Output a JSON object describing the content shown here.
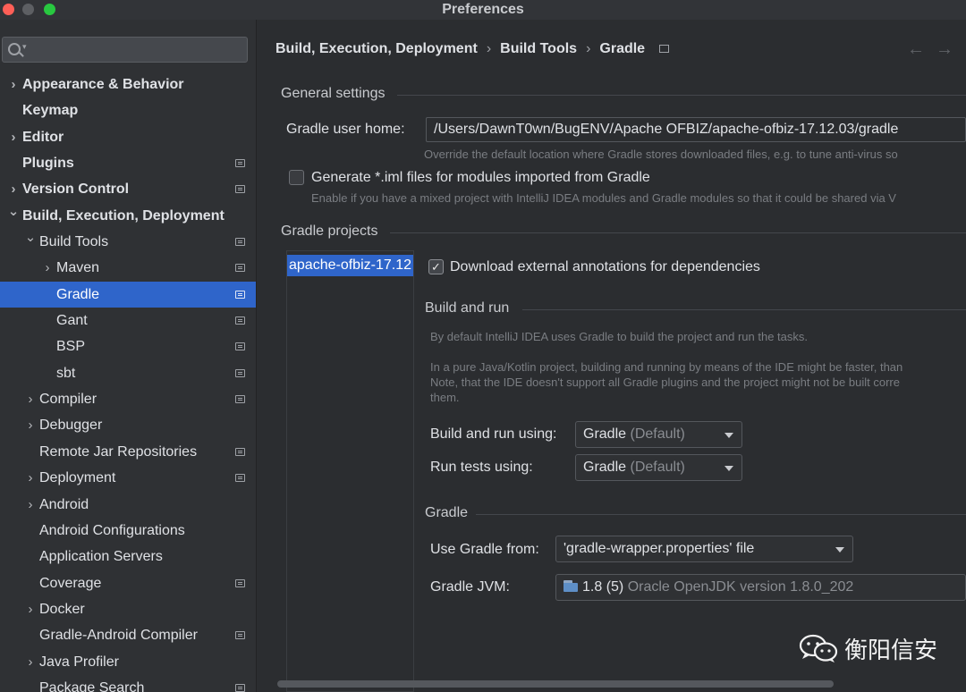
{
  "window": {
    "title": "Preferences"
  },
  "sidebar": {
    "search": {
      "placeholder": "",
      "value": ""
    },
    "items": [
      {
        "label": "Appearance & Behavior",
        "bold": true,
        "chevron": "collapsed",
        "indent": 0,
        "settings_icon": false
      },
      {
        "label": "Keymap",
        "bold": true,
        "chevron": "none",
        "indent": 0,
        "settings_icon": false
      },
      {
        "label": "Editor",
        "bold": true,
        "chevron": "collapsed",
        "indent": 0,
        "settings_icon": false
      },
      {
        "label": "Plugins",
        "bold": true,
        "chevron": "none",
        "indent": 0,
        "settings_icon": true
      },
      {
        "label": "Version Control",
        "bold": true,
        "chevron": "collapsed",
        "indent": 0,
        "settings_icon": true
      },
      {
        "label": "Build, Execution, Deployment",
        "bold": true,
        "chevron": "expanded",
        "indent": 0,
        "settings_icon": false
      },
      {
        "label": "Build Tools",
        "bold": false,
        "chevron": "expanded",
        "indent": 1,
        "settings_icon": true
      },
      {
        "label": "Maven",
        "bold": false,
        "chevron": "collapsed",
        "indent": 2,
        "settings_icon": true
      },
      {
        "label": "Gradle",
        "bold": false,
        "chevron": "none",
        "indent": 2,
        "settings_icon": true,
        "selected": true
      },
      {
        "label": "Gant",
        "bold": false,
        "chevron": "none",
        "indent": 2,
        "settings_icon": true
      },
      {
        "label": "BSP",
        "bold": false,
        "chevron": "none",
        "indent": 2,
        "settings_icon": true
      },
      {
        "label": "sbt",
        "bold": false,
        "chevron": "none",
        "indent": 2,
        "settings_icon": true
      },
      {
        "label": "Compiler",
        "bold": false,
        "chevron": "collapsed",
        "indent": 1,
        "settings_icon": true
      },
      {
        "label": "Debugger",
        "bold": false,
        "chevron": "collapsed",
        "indent": 1,
        "settings_icon": false
      },
      {
        "label": "Remote Jar Repositories",
        "bold": false,
        "chevron": "none",
        "indent": 1,
        "settings_icon": true
      },
      {
        "label": "Deployment",
        "bold": false,
        "chevron": "collapsed",
        "indent": 1,
        "settings_icon": true
      },
      {
        "label": "Android",
        "bold": false,
        "chevron": "collapsed",
        "indent": 1,
        "settings_icon": false
      },
      {
        "label": "Android Configurations",
        "bold": false,
        "chevron": "none",
        "indent": 1,
        "settings_icon": false
      },
      {
        "label": "Application Servers",
        "bold": false,
        "chevron": "none",
        "indent": 1,
        "settings_icon": false
      },
      {
        "label": "Coverage",
        "bold": false,
        "chevron": "none",
        "indent": 1,
        "settings_icon": true
      },
      {
        "label": "Docker",
        "bold": false,
        "chevron": "collapsed",
        "indent": 1,
        "settings_icon": false
      },
      {
        "label": "Gradle-Android Compiler",
        "bold": false,
        "chevron": "none",
        "indent": 1,
        "settings_icon": true
      },
      {
        "label": "Java Profiler",
        "bold": false,
        "chevron": "collapsed",
        "indent": 1,
        "settings_icon": false
      },
      {
        "label": "Package Search",
        "bold": false,
        "chevron": "none",
        "indent": 1,
        "settings_icon": true
      }
    ]
  },
  "breadcrumb": {
    "items": [
      "Build, Execution, Deployment",
      "Build Tools",
      "Gradle"
    ]
  },
  "general": {
    "section_title": "General settings",
    "user_home_label": "Gradle user home:",
    "user_home_value": "/Users/DawnT0wn/BugENV/Apache OFBIZ/apache-ofbiz-17.12.03/gradle",
    "user_home_hint": "Override the default location where Gradle stores downloaded files, e.g. to tune anti-virus so",
    "generate_iml_label": "Generate *.iml files for modules imported from Gradle",
    "generate_iml_checked": false,
    "generate_iml_hint": "Enable if you have a mixed project with IntelliJ IDEA modules and Gradle modules so that it could be shared via V"
  },
  "projects": {
    "section_title": "Gradle projects",
    "items": [
      "apache-ofbiz-17.12"
    ],
    "download_annotations_label": "Download external annotations for dependencies",
    "download_annotations_checked": true,
    "build_run": {
      "title": "Build and run",
      "desc1": "By default IntelliJ IDEA uses Gradle to build the project and run the tasks.",
      "desc2_line1": "In a pure Java/Kotlin project, building and running by means of the IDE might be faster, than",
      "desc2_line2": "Note, that the IDE doesn't support all Gradle plugins and the project might not be built corre",
      "desc2_line3": "them.",
      "build_using_label": "Build and run using:",
      "build_using_value": "Gradle",
      "build_using_suffix": "(Default)",
      "tests_using_label": "Run tests using:",
      "tests_using_value": "Gradle",
      "tests_using_suffix": "(Default)"
    },
    "gradle": {
      "title": "Gradle",
      "use_from_label": "Use Gradle from:",
      "use_from_value": "'gradle-wrapper.properties' file",
      "jvm_label": "Gradle JVM:",
      "jvm_value": "1.8 (5)",
      "jvm_detail": "Oracle OpenJDK version 1.8.0_202"
    }
  },
  "watermark": {
    "text": "衡阳信安"
  }
}
